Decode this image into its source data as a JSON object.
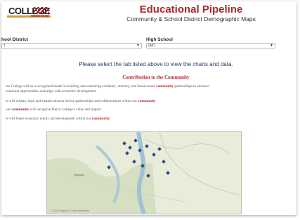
{
  "header": {
    "logo_text": "COLLEGE",
    "logo_sub": "rainierland",
    "title": "Educational Pipeline",
    "subtitle": "Community & School District Demographic Maps"
  },
  "filters": {
    "school_district_label": "hool District",
    "school_district_value": "1",
    "high_school_label": "High School",
    "high_school_value": "(All)"
  },
  "main": {
    "prompt": "Please select the tab listed above to view the charts and data."
  },
  "contribution": {
    "title": "Contribution to the Community",
    "para1_a": "rce College will be a recognized leader in building and sustaining academic, industry, and broad-based ",
    "para1_b": "community",
    "para1_c": " partnerships to advance",
    "para1_d": "ucational opportunities and align with economic development.",
    "para2_a": "le will initiate, lead, and sustain mission-driven partnerships and collaborations within our ",
    "para2_b": "community",
    "para3_a": "our ",
    "para3_b": "community",
    "para3_c": " will recognize Pierce College's value and impact.",
    "para4_a": "le will foster economic equity and development within our ",
    "para4_b": "community"
  },
  "map": {
    "credit": "© 2020 Mapbox © OpenStreetMap",
    "place_label": "Olympia"
  },
  "colors": {
    "accent": "#b0262c",
    "marker": "#2c4a8a",
    "prompt": "#1f3e6e"
  }
}
